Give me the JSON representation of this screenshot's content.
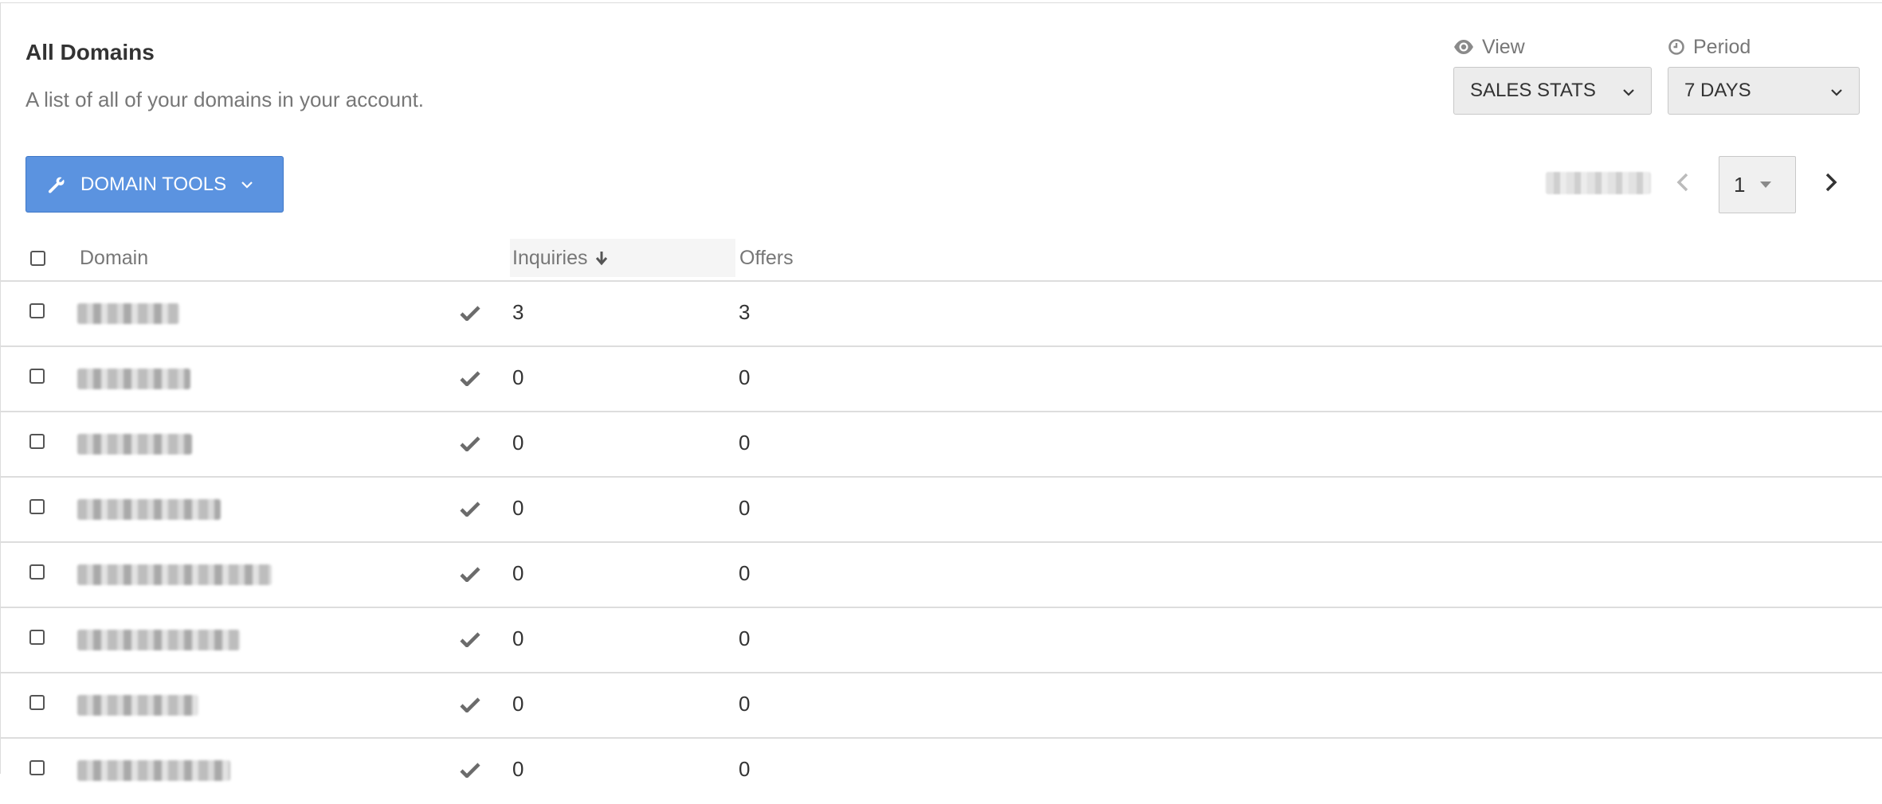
{
  "header": {
    "title": "All Domains",
    "subtitle": "A list of all of your domains in your account."
  },
  "filters": {
    "view": {
      "label": "View",
      "icon": "eye-icon",
      "value": "SALES STATS"
    },
    "period": {
      "label": "Period",
      "icon": "clock-icon",
      "value": "7 DAYS"
    }
  },
  "toolbar": {
    "tools_label": "DOMAIN TOOLS"
  },
  "pagination": {
    "current_page": "1"
  },
  "table": {
    "columns": {
      "domain": "Domain",
      "inquiries": "Inquiries",
      "offers": "Offers"
    },
    "sort": {
      "column": "inquiries",
      "direction": "descending"
    },
    "rows": [
      {
        "domain": "",
        "verified": true,
        "inquiries": "3",
        "offers": "3"
      },
      {
        "domain": "",
        "verified": true,
        "inquiries": "0",
        "offers": "0"
      },
      {
        "domain": "",
        "verified": true,
        "inquiries": "0",
        "offers": "0"
      },
      {
        "domain": "",
        "verified": true,
        "inquiries": "0",
        "offers": "0"
      },
      {
        "domain": "",
        "verified": true,
        "inquiries": "0",
        "offers": "0"
      },
      {
        "domain": "",
        "verified": true,
        "inquiries": "0",
        "offers": "0"
      },
      {
        "domain": "",
        "verified": true,
        "inquiries": "0",
        "offers": "0"
      },
      {
        "domain": "",
        "verified": true,
        "inquiries": "0",
        "offers": "0"
      }
    ]
  },
  "colors": {
    "accent": "#5b93e0",
    "muted_text": "#777777",
    "text": "#333333",
    "border": "#dddddd"
  }
}
